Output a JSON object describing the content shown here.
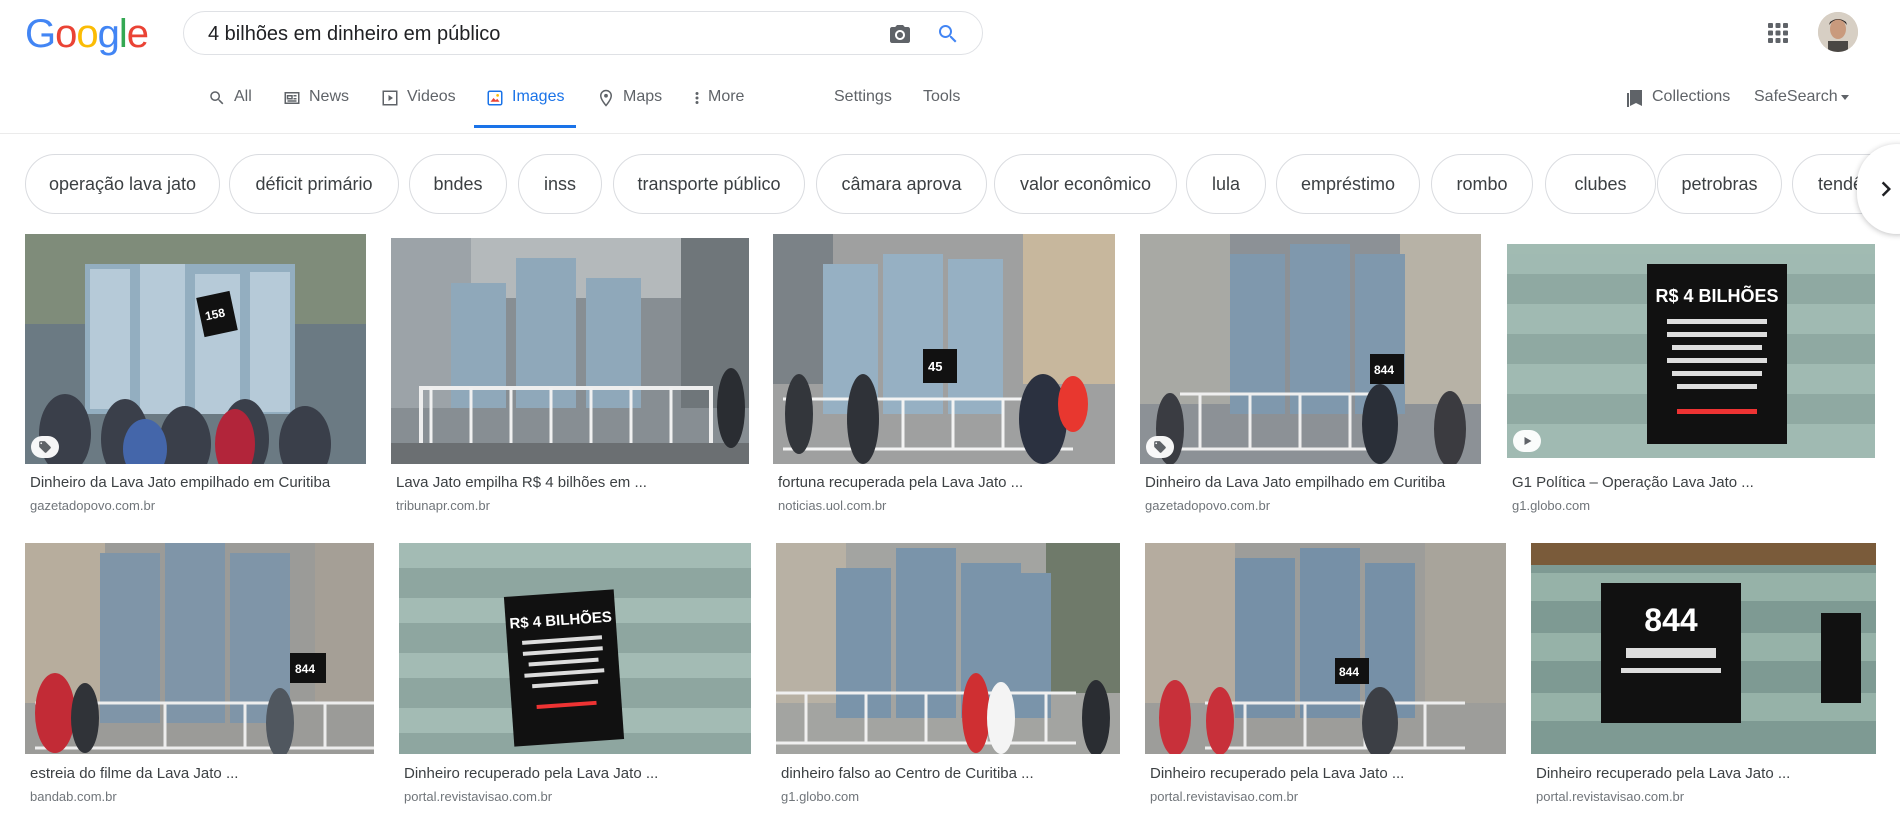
{
  "header": {
    "logo": [
      "G",
      "o",
      "o",
      "g",
      "l",
      "e"
    ],
    "logo_colors": [
      "#4285F4",
      "#EA4335",
      "#FBBC05",
      "#4285F4",
      "#34A853",
      "#EA4335"
    ],
    "search_value": "4 bilhões em dinheiro em público",
    "icons": [
      "camera-icon",
      "search-icon",
      "apps-icon"
    ]
  },
  "nav": {
    "tabs": [
      {
        "label": "All",
        "icon": "search-icon"
      },
      {
        "label": "News",
        "icon": "news-icon"
      },
      {
        "label": "Videos",
        "icon": "video-icon"
      },
      {
        "label": "Images",
        "icon": "image-icon",
        "active": true
      },
      {
        "label": "Maps",
        "icon": "map-pin-icon"
      },
      {
        "label": "More",
        "icon": "more-vert-icon"
      }
    ],
    "settings": "Settings",
    "tools": "Tools",
    "collections": "Collections",
    "safesearch": "SafeSearch"
  },
  "chips": [
    "operação lava jato",
    "déficit primário",
    "bndes",
    "inss",
    "transporte público",
    "câmara aprova",
    "valor econômico",
    "lula",
    "empréstimo",
    "rombo",
    "clubes",
    "petrobras",
    "tendência"
  ],
  "results": [
    {
      "title": "Dinheiro da Lava Jato empilhado em Curitiba",
      "source": "gazetadopovo.com.br",
      "badge": "tag",
      "sign": "158"
    },
    {
      "title": "Lava Jato empilha R$ 4 bilhões em ...",
      "source": "tribunapr.com.br",
      "badge": "",
      "sign": ""
    },
    {
      "title": "fortuna recuperada pela Lava Jato ...",
      "source": "noticias.uol.com.br",
      "badge": "",
      "sign": "45"
    },
    {
      "title": "Dinheiro da Lava Jato empilhado em Curitiba",
      "source": "gazetadopovo.com.br",
      "badge": "tag",
      "sign": "844"
    },
    {
      "title": "G1 Política – Operação Lava Jato ...",
      "source": "g1.globo.com",
      "badge": "play",
      "sign": "R$ 4 BILHÕES"
    },
    {
      "title": "estreia do filme da Lava Jato ...",
      "source": "bandab.com.br",
      "badge": "",
      "sign": "844"
    },
    {
      "title": "Dinheiro recuperado pela Lava Jato ...",
      "source": "portal.revistavisao.com.br",
      "badge": "",
      "sign": "R$ 4 BILHÕES"
    },
    {
      "title": "dinheiro falso ao Centro de Curitiba ...",
      "source": "g1.globo.com",
      "badge": "",
      "sign": ""
    },
    {
      "title": "Dinheiro recuperado pela Lava Jato ...",
      "source": "portal.revistavisao.com.br",
      "badge": "",
      "sign": "844"
    },
    {
      "title": "Dinheiro recuperado pela Lava Jato ...",
      "source": "portal.revistavisao.com.br",
      "badge": "",
      "sign": "844"
    }
  ],
  "colors": {
    "accent": "#1a73e8",
    "text": "#202124",
    "muted": "#5f6368",
    "source": "#70757a"
  }
}
